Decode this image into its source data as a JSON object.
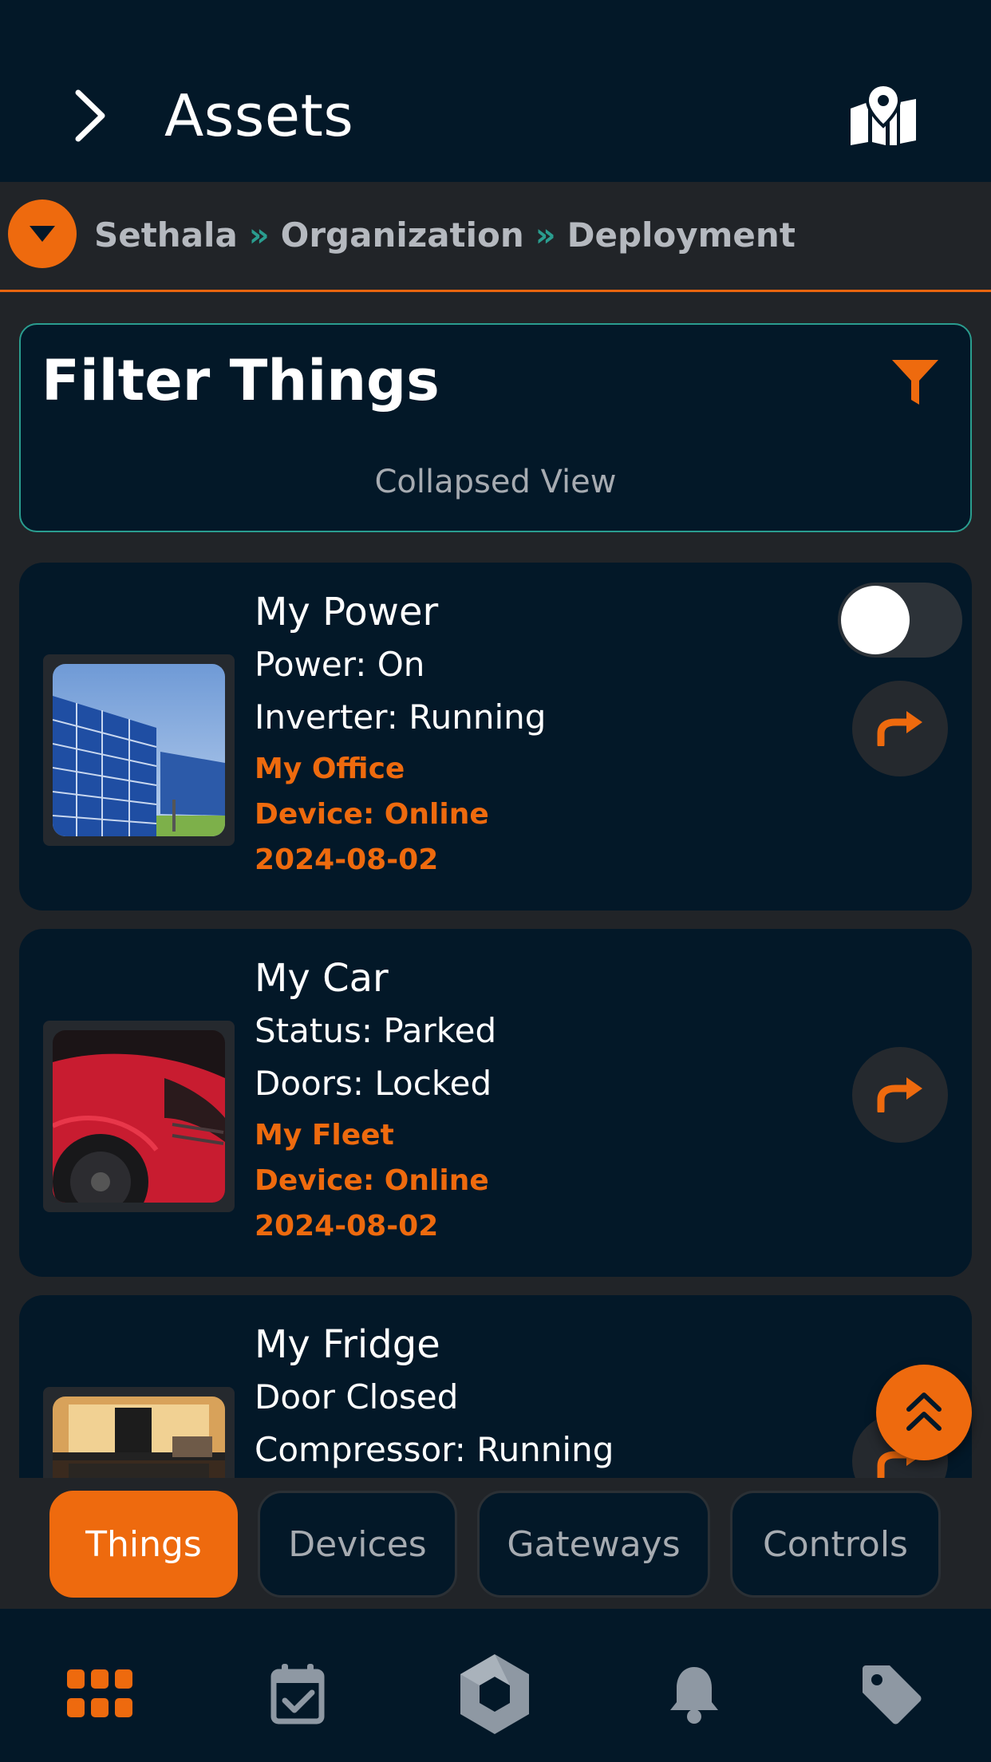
{
  "header": {
    "title": "Assets"
  },
  "breadcrumb": {
    "items": [
      "Sethala",
      "Organization",
      "Deployment"
    ],
    "separator": "»"
  },
  "filter": {
    "title": "Filter Things",
    "subtitle": "Collapsed View"
  },
  "cards": [
    {
      "name": "My Power",
      "line1": "Power: On",
      "line2": "Inverter: Running",
      "location": "My Office",
      "device": "Device: Online",
      "date": "2024-08-02",
      "image": "solar-panels",
      "toggle_on": false
    },
    {
      "name": "My Car",
      "line1": "Status: Parked",
      "line2": "Doors: Locked",
      "location": "My Fleet",
      "device": "Device: Online",
      "date": "2024-08-02",
      "image": "red-sports-car"
    },
    {
      "name": "My Fridge",
      "line1": "Door Closed",
      "line2": "Compressor: Running",
      "image": "fridge-interior"
    }
  ],
  "tabs": {
    "things": "Things",
    "devices": "Devices",
    "gateways": "Gateways",
    "controls": "Controls",
    "active": "Things"
  },
  "bottom_nav": [
    "grid-icon",
    "calendar-check-icon",
    "hexagon-logo-icon",
    "bell-icon",
    "tag-icon"
  ],
  "colors": {
    "accent": "#ee6a0e",
    "background": "#212428",
    "panel": "#031828",
    "teal": "#2a9d8f"
  }
}
